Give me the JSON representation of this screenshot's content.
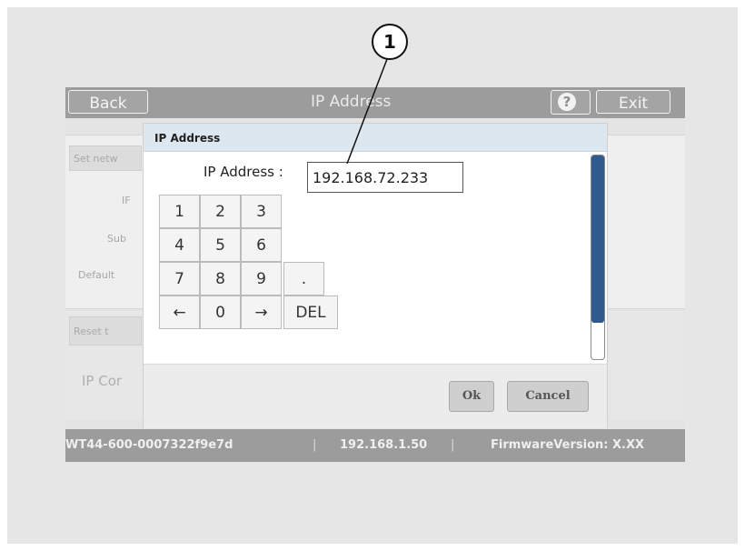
{
  "header": {
    "back_label": "Back",
    "title": "IP Address",
    "help_label": "?",
    "exit_label": "Exit"
  },
  "background": {
    "set_network_label": "Set netw",
    "labels": [
      "IF",
      "Sub",
      "Default"
    ],
    "reset_label": "Reset t",
    "ip_config_label": "IP Cor"
  },
  "dialog": {
    "title": "IP Address",
    "field_label": "IP Address :",
    "field_value": "192.168.72.233",
    "keypad": [
      [
        "1",
        "2",
        "3"
      ],
      [
        "4",
        "5",
        "6"
      ],
      [
        "7",
        "8",
        "9",
        "."
      ],
      [
        "←",
        "0",
        "→",
        "DEL"
      ]
    ],
    "ok_label": "Ok",
    "cancel_label": "Cancel"
  },
  "statusbar": {
    "device_id": "WT44-600-0007322f9e7d",
    "separator": "|",
    "ip": "192.168.1.50",
    "firmware": "FirmwareVersion: X.XX"
  },
  "callout": {
    "number": "1"
  },
  "colors": {
    "bar_gray": "#9c9c9c",
    "dialog_header": "#dde7ef",
    "scroll_thumb": "#2e5a8e"
  }
}
